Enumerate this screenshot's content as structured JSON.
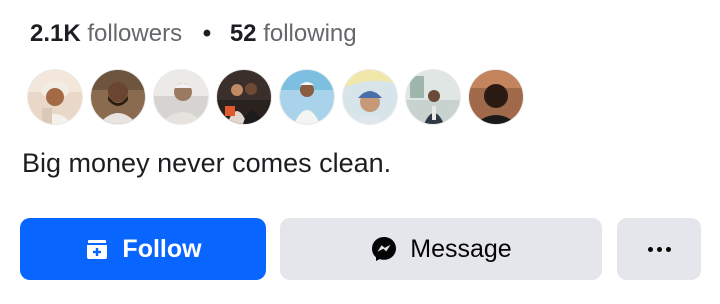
{
  "stats": {
    "followers_count": "2.1K",
    "followers_label": "followers",
    "separator": "•",
    "following_count": "52",
    "following_label": "following"
  },
  "follower_avatars": [
    {
      "name": "follower-avatar-1"
    },
    {
      "name": "follower-avatar-2"
    },
    {
      "name": "follower-avatar-3"
    },
    {
      "name": "follower-avatar-4"
    },
    {
      "name": "follower-avatar-5"
    },
    {
      "name": "follower-avatar-6"
    },
    {
      "name": "follower-avatar-7"
    },
    {
      "name": "follower-avatar-8"
    }
  ],
  "bio": "Big money never comes clean.",
  "actions": {
    "follow_label": "Follow",
    "follow_icon": "add-friend-icon",
    "message_label": "Message",
    "message_icon": "messenger-icon",
    "more_icon": "more-options-icon"
  },
  "colors": {
    "primary": "#0866ff",
    "secondary_button": "#e4e6eb",
    "muted_text": "#65676b"
  }
}
